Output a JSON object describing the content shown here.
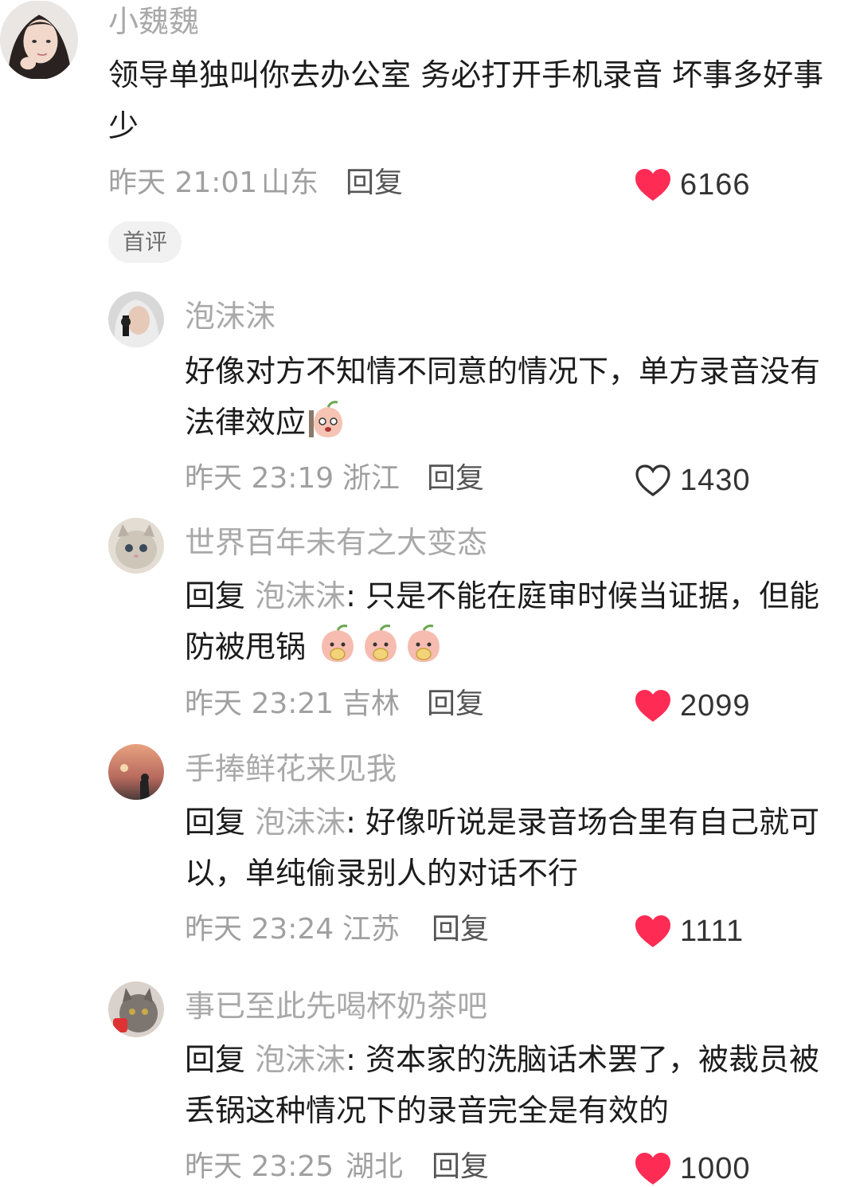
{
  "comments": [
    {
      "username": "小魏魏",
      "content": "领导单独叫你去办公室 务必打开手机录音 坏事多好事少",
      "time": "昨天 21:01",
      "location": "山东",
      "reply_label": "回复",
      "likes": "6166",
      "liked": true,
      "badge": "首评"
    },
    {
      "username": "泡沫沫",
      "content": "好像对方不知情不同意的情况下，单方录音没有法律效应",
      "time": "昨天 23:19",
      "location": "浙江",
      "reply_label": "回复",
      "likes": "1430",
      "liked": false
    },
    {
      "username": "世界百年未有之大变态",
      "reply_prefix": "回复",
      "reply_target": "泡沫沫",
      "content": ": 只是不能在庭审时候当证据，但能防被甩锅",
      "time": "昨天 23:21",
      "location": "吉林",
      "reply_label": "回复",
      "likes": "2099",
      "liked": true
    },
    {
      "username": "手捧鲜花来见我",
      "reply_prefix": "回复",
      "reply_target": "泡沫沫",
      "content": ": 好像听说是录音场合里有自己就可以，单纯偷录别人的对话不行",
      "time": "昨天 23:24",
      "location": "江苏",
      "reply_label": "回复",
      "likes": "1111",
      "liked": true
    },
    {
      "username": "事已至此先喝杯奶茶吧",
      "reply_prefix": "回复",
      "reply_target": "泡沫沫",
      "content": ": 资本家的洗脑话术罢了，被裁员被丢锅这种情况下的录音完全是有效的",
      "time": "昨天 23:25",
      "location": "湖北",
      "reply_label": "回复",
      "likes": "1000",
      "liked": true
    }
  ],
  "colors": {
    "heart": "#fe2c55",
    "meta": "#a0a0a0",
    "username": "#a9a9a9"
  }
}
